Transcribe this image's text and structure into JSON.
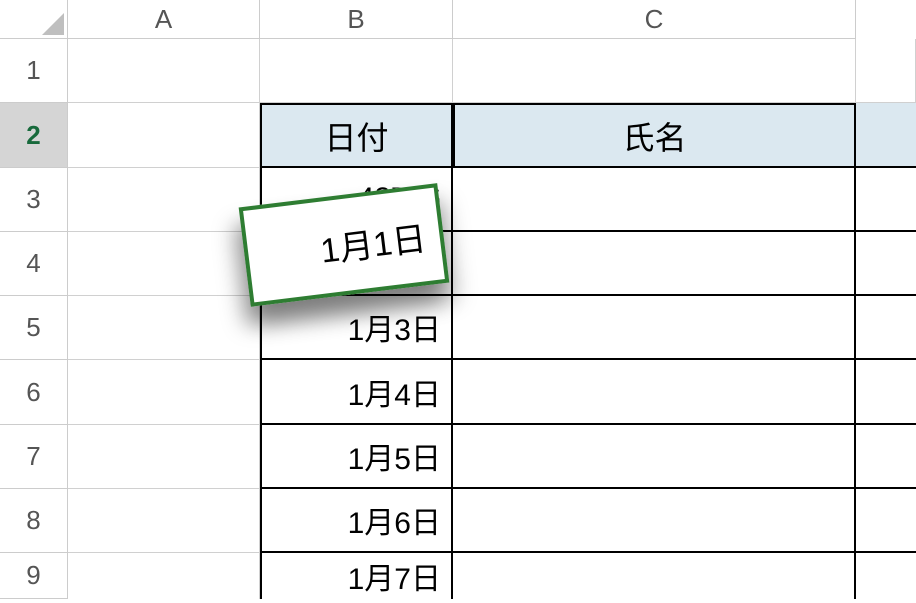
{
  "columns": {
    "A": "A",
    "B": "B",
    "C": "C"
  },
  "rows": {
    "r1": "1",
    "r2": "2",
    "r3": "3",
    "r4": "4",
    "r5": "5",
    "r6": "6",
    "r7": "7",
    "r8": "8",
    "r9": "9"
  },
  "headers": {
    "date": "日付",
    "name": "氏名"
  },
  "dates": {
    "d3": "42736",
    "d5": "1月3日",
    "d6": "1月4日",
    "d7": "1月5日",
    "d8": "1月6日",
    "d9": "1月7日"
  },
  "card": {
    "value": "1月1日"
  },
  "row_heights": {
    "h1": 64,
    "h2": 65,
    "h3": 64,
    "h4": 64,
    "h5": 64,
    "h6": 65,
    "h7": 64,
    "h8": 64,
    "h9": 46
  },
  "selected_row": 2
}
